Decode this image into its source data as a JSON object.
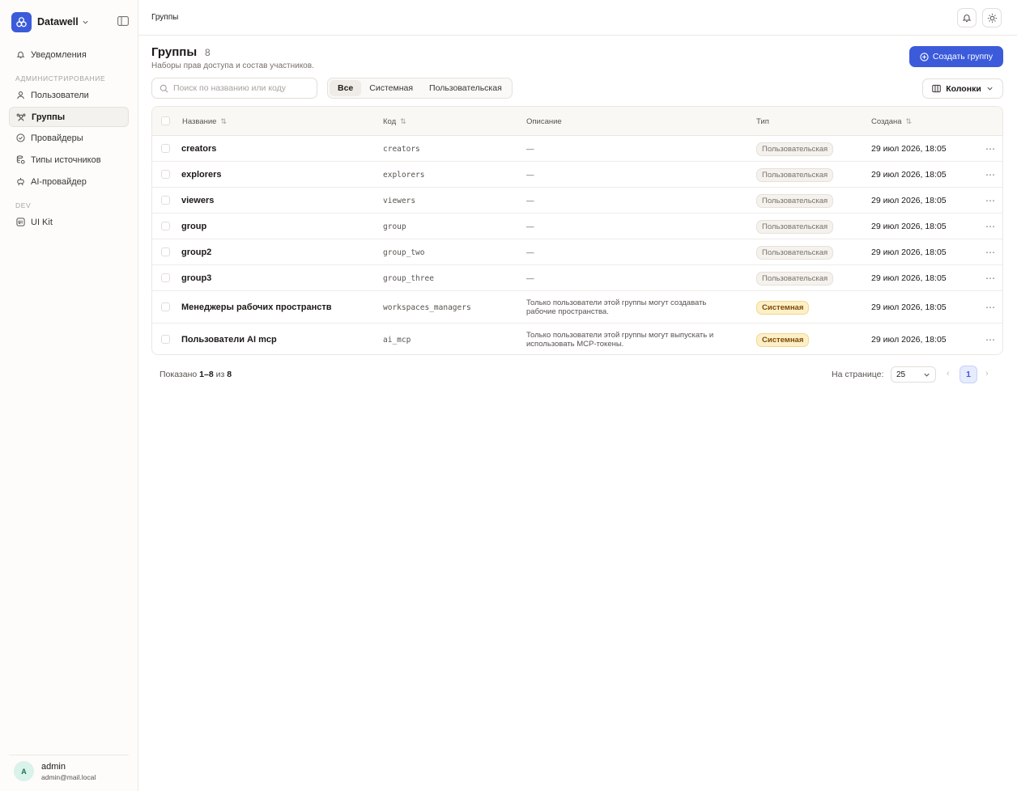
{
  "sidebar": {
    "brand": "Datawell",
    "nav_notifications": "Уведомления",
    "section_admin": "Администрирование",
    "items": [
      {
        "label": "Пользователи"
      },
      {
        "label": "Группы"
      },
      {
        "label": "Провайдеры"
      },
      {
        "label": "Типы источников"
      },
      {
        "label": "AI-провайдер"
      }
    ],
    "section_dev": "DEV",
    "ui_kit": "UI Kit",
    "user": {
      "initial": "A",
      "name": "admin",
      "email": "admin@mail.local"
    }
  },
  "topbar": {
    "breadcrumb": "Группы"
  },
  "header": {
    "title": "Группы",
    "count": "8",
    "subtitle": "Наборы прав доступа и состав участников.",
    "create_label": "Создать группу"
  },
  "filters": {
    "search_placeholder": "Поиск по названию или коду",
    "tabs": [
      "Все",
      "Системная",
      "Пользовательская"
    ],
    "active_tab": "Все",
    "columns_label": "Колонки"
  },
  "table": {
    "headers": {
      "name": "Название",
      "code": "Код",
      "description": "Описание",
      "type": "Тип",
      "created": "Создана"
    },
    "rows": [
      {
        "name": "creators",
        "code": "creators",
        "description": "—",
        "type": "Пользовательская",
        "created": "29 июл 2026, 18:05"
      },
      {
        "name": "explorers",
        "code": "explorers",
        "description": "—",
        "type": "Пользовательская",
        "created": "29 июл 2026, 18:05"
      },
      {
        "name": "viewers",
        "code": "viewers",
        "description": "—",
        "type": "Пользовательская",
        "created": "29 июл 2026, 18:05"
      },
      {
        "name": "group",
        "code": "group",
        "description": "—",
        "type": "Пользовательская",
        "created": "29 июл 2026, 18:05"
      },
      {
        "name": "group2",
        "code": "group_two",
        "description": "—",
        "type": "Пользовательская",
        "created": "29 июл 2026, 18:05"
      },
      {
        "name": "group3",
        "code": "group_three",
        "description": "—",
        "type": "Пользовательская",
        "created": "29 июл 2026, 18:05"
      },
      {
        "name": "Менеджеры рабочих пространств",
        "code": "workspaces_managers",
        "description": "Только пользователи этой группы могут создавать рабочие пространства.",
        "type": "Системная",
        "created": "29 июл 2026, 18:05"
      },
      {
        "name": "Пользователи AI mcp",
        "code": "ai_mcp",
        "description": "Только пользователи этой группы могут выпускать и использовать MCP-токены.",
        "type": "Системная",
        "created": "29 июл 2026, 18:05"
      }
    ]
  },
  "pagination": {
    "shown_prefix": "Показано",
    "shown_range": "1–8",
    "shown_of": "из",
    "total": "8",
    "per_page_label": "На странице:",
    "per_page": "25",
    "current_page": "1"
  },
  "colors": {
    "accent": "#3b5bdb",
    "system_badge": "#fdf0c9"
  }
}
